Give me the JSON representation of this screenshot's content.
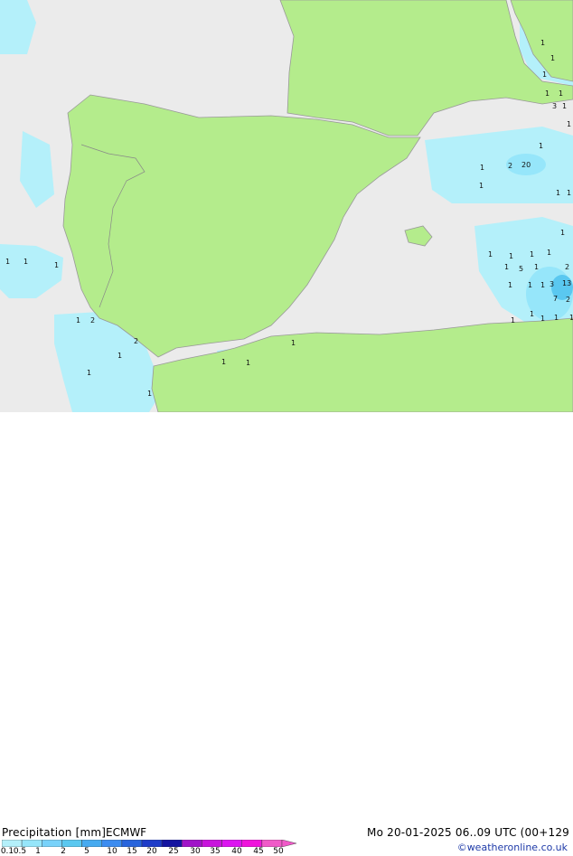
{
  "header": {
    "title": "Precipitation [mm]",
    "model": "ECMWF",
    "datetime": "Mo 20-01-2025 06..09 UTC (00+129",
    "credit": "©weatheronline.co.uk"
  },
  "legend": {
    "tick_labels": [
      "0.1",
      "0.5",
      "1",
      "2",
      "5",
      "10",
      "15",
      "20",
      "25",
      "30",
      "35",
      "40",
      "45",
      "50"
    ],
    "colors": [
      "#b4f0fa",
      "#96e6fa",
      "#78d2fa",
      "#5ac8f0",
      "#46aaf0",
      "#3c8cf0",
      "#2864dc",
      "#1e3cc8",
      "#1414a0",
      "#a014c8",
      "#c814dc",
      "#dc14f0",
      "#f014dc",
      "#f05ac8"
    ]
  },
  "map": {
    "colors": {
      "land": "#b4ec8c",
      "sea": "#ebebeb",
      "coast": "#999999",
      "precip_light": "#b4f0fa",
      "precip_medium": "#96e6fa",
      "precip_heavy": "#5ac8f0"
    },
    "labels": {
      "v1": "1",
      "v2": "1",
      "v3": "2",
      "v4": "1",
      "v5": "1",
      "v6": "2",
      "v7": "1",
      "v8": "1",
      "v9": "1",
      "v10": "1",
      "v11": "1",
      "v12": "2",
      "v13": "1",
      "v14": "1",
      "v15": "1",
      "v16": "5",
      "v17": "1",
      "v18": "3",
      "v19": "7",
      "v20": "2",
      "v21": "13",
      "v22": "2",
      "v23": "1",
      "v24": "1",
      "v25": "1",
      "v26": "1",
      "v27": "20",
      "v28": "1",
      "v29": "1",
      "v30": "1",
      "v31": "1",
      "v32": "1",
      "v33": "3",
      "v34": "1",
      "v35": "1",
      "v36": "1",
      "v37": "1",
      "v38": "1",
      "v39": "1",
      "v40": "1",
      "v41": "1",
      "v42": "1",
      "v43": "1",
      "v44": "1",
      "v45": "1",
      "v46": "1",
      "v47": "1",
      "v48": "1"
    }
  }
}
